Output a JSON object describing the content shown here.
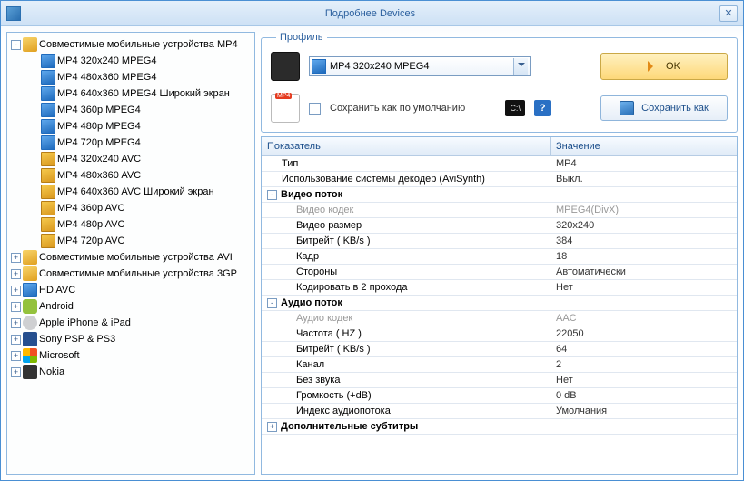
{
  "title": "Подробнее Devices",
  "tree": [
    {
      "exp": "-",
      "icon": "ic-folder",
      "label": "Совместимые мобильные устройства MP4",
      "depth": 0
    },
    {
      "exp": "",
      "icon": "ic-mp4",
      "label": "MP4 320x240 MPEG4",
      "depth": 1
    },
    {
      "exp": "",
      "icon": "ic-mp4",
      "label": "MP4 480x360 MPEG4",
      "depth": 1
    },
    {
      "exp": "",
      "icon": "ic-mp4",
      "label": "MP4 640x360 MPEG4 Широкий экран",
      "depth": 1
    },
    {
      "exp": "",
      "icon": "ic-mp4",
      "label": "MP4 360p MPEG4",
      "depth": 1
    },
    {
      "exp": "",
      "icon": "ic-mp4",
      "label": "MP4 480p MPEG4",
      "depth": 1
    },
    {
      "exp": "",
      "icon": "ic-mp4",
      "label": "MP4 720p MPEG4",
      "depth": 1
    },
    {
      "exp": "",
      "icon": "ic-avc",
      "label": "MP4 320x240 AVC",
      "depth": 1
    },
    {
      "exp": "",
      "icon": "ic-avc",
      "label": "MP4 480x360 AVC",
      "depth": 1
    },
    {
      "exp": "",
      "icon": "ic-avc",
      "label": "MP4 640x360 AVC Широкий экран",
      "depth": 1
    },
    {
      "exp": "",
      "icon": "ic-avc",
      "label": "MP4 360p AVC",
      "depth": 1
    },
    {
      "exp": "",
      "icon": "ic-avc",
      "label": "MP4 480p AVC",
      "depth": 1
    },
    {
      "exp": "",
      "icon": "ic-avc",
      "label": "MP4 720p AVC",
      "depth": 1
    },
    {
      "exp": "+",
      "icon": "ic-folder",
      "label": "Совместимые мобильные устройства AVI",
      "depth": 0
    },
    {
      "exp": "+",
      "icon": "ic-folder",
      "label": "Совместимые мобильные устройства 3GP",
      "depth": 0
    },
    {
      "exp": "+",
      "icon": "ic-mp4",
      "label": "HD AVC",
      "depth": 0
    },
    {
      "exp": "+",
      "icon": "ic-android",
      "label": "Android",
      "depth": 0
    },
    {
      "exp": "+",
      "icon": "ic-apple",
      "label": "Apple iPhone & iPad",
      "depth": 0
    },
    {
      "exp": "+",
      "icon": "ic-sony",
      "label": "Sony PSP & PS3",
      "depth": 0
    },
    {
      "exp": "+",
      "icon": "ic-ms",
      "label": "Microsoft",
      "depth": 0
    },
    {
      "exp": "+",
      "icon": "ic-nokia",
      "label": "Nokia",
      "depth": 0
    }
  ],
  "profile": {
    "legend": "Профиль",
    "selected": "MP4 320x240 MPEG4",
    "save_default": "Сохранить как по умолчанию",
    "ok": "OK",
    "save_as": "Сохранить как",
    "cmd": "C:\\",
    "help": "?"
  },
  "grid": {
    "header_name": "Показатель",
    "header_val": "Значение",
    "rows": [
      {
        "type": "row",
        "indent": 0,
        "name": "Тип",
        "val": "MP4"
      },
      {
        "type": "row",
        "indent": 0,
        "name": "Использование системы декодер (AviSynth)",
        "val": "Выкл."
      },
      {
        "type": "group",
        "exp": "-",
        "name": "Видео поток"
      },
      {
        "type": "row",
        "indent": 1,
        "name": "Видео кодек",
        "val": "MPEG4(DivX)",
        "faded": true
      },
      {
        "type": "row",
        "indent": 1,
        "name": "Видео размер",
        "val": "320x240"
      },
      {
        "type": "row",
        "indent": 1,
        "name": "Битрейт ( KB/s )",
        "val": "384"
      },
      {
        "type": "row",
        "indent": 1,
        "name": "Кадр",
        "val": "18"
      },
      {
        "type": "row",
        "indent": 1,
        "name": "Стороны",
        "val": "Автоматически"
      },
      {
        "type": "row",
        "indent": 1,
        "name": "Кодировать в 2 прохода",
        "val": "Нет"
      },
      {
        "type": "group",
        "exp": "-",
        "name": "Аудио поток"
      },
      {
        "type": "row",
        "indent": 1,
        "name": "Аудио кодек",
        "val": "AAC",
        "faded": true
      },
      {
        "type": "row",
        "indent": 1,
        "name": "Частота ( HZ )",
        "val": "22050"
      },
      {
        "type": "row",
        "indent": 1,
        "name": "Битрейт ( KB/s )",
        "val": "64"
      },
      {
        "type": "row",
        "indent": 1,
        "name": "Канал",
        "val": "2"
      },
      {
        "type": "row",
        "indent": 1,
        "name": "Без звука",
        "val": "Нет"
      },
      {
        "type": "row",
        "indent": 1,
        "name": "Громкость (+dB)",
        "val": "0 dB"
      },
      {
        "type": "row",
        "indent": 1,
        "name": "Индекс аудиопотока",
        "val": "Умолчания"
      },
      {
        "type": "group",
        "exp": "+",
        "name": "Дополнительные субтитры"
      }
    ]
  }
}
